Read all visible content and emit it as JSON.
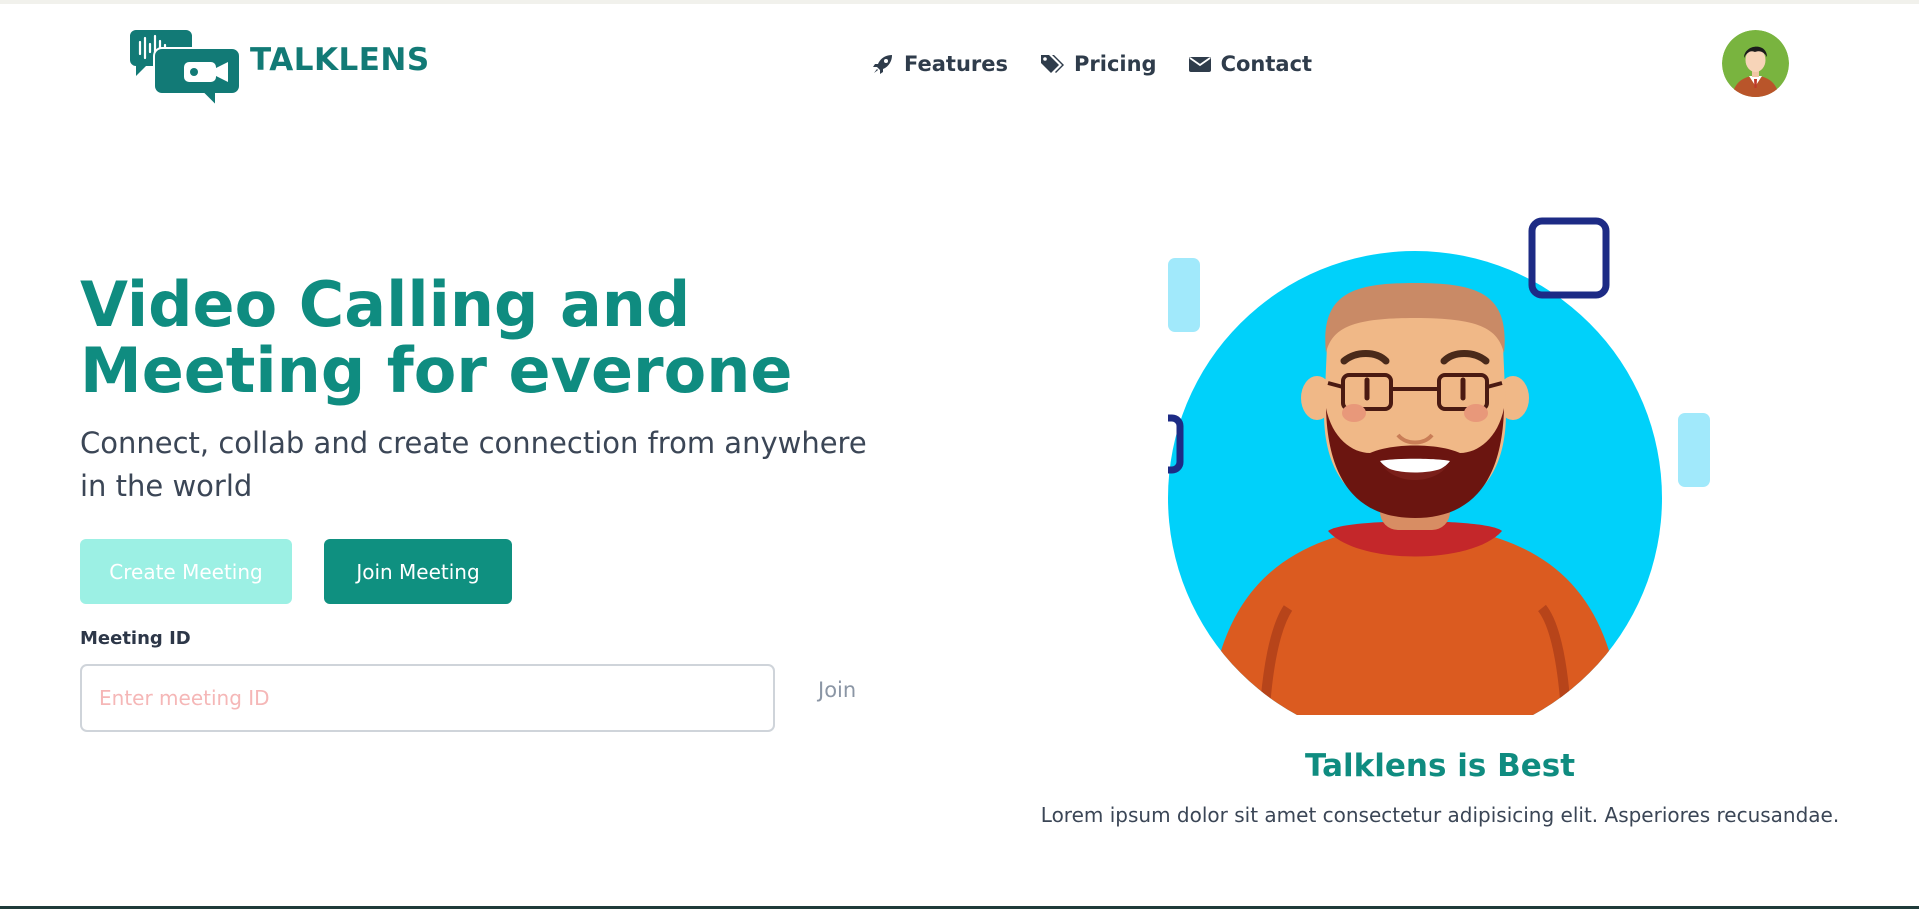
{
  "brand": {
    "name": "TALKLENS",
    "color": "#127a76"
  },
  "nav": {
    "items": [
      {
        "label": "Features",
        "icon": "rocket-icon"
      },
      {
        "label": "Pricing",
        "icon": "tags-icon"
      },
      {
        "label": "Contact",
        "icon": "envelope-icon"
      }
    ]
  },
  "user": {
    "avatar": "user-avatar"
  },
  "hero": {
    "title_line1": "Video Calling and",
    "title_line2": "Meeting for everone",
    "subtitle_line1": "Connect, collab and create connection from anywhere",
    "subtitle_line2": "in the world",
    "create_button": "Create Meeting",
    "join_meeting_button": "Join Meeting",
    "meeting_id_label": "Meeting ID",
    "meeting_id_value": "",
    "meeting_id_placeholder": "Enter meeting ID",
    "join_label": "Join"
  },
  "feature": {
    "title": "Talklens is Best",
    "text": "Lorem ipsum dolor sit amet consectetur adipisicing elit. Asperiores recusandae."
  },
  "colors": {
    "accent": "#0f9080",
    "accent_light": "#9cf0e4",
    "illustration_bg": "#00d1fa",
    "square_outline": "#1d2b85"
  }
}
